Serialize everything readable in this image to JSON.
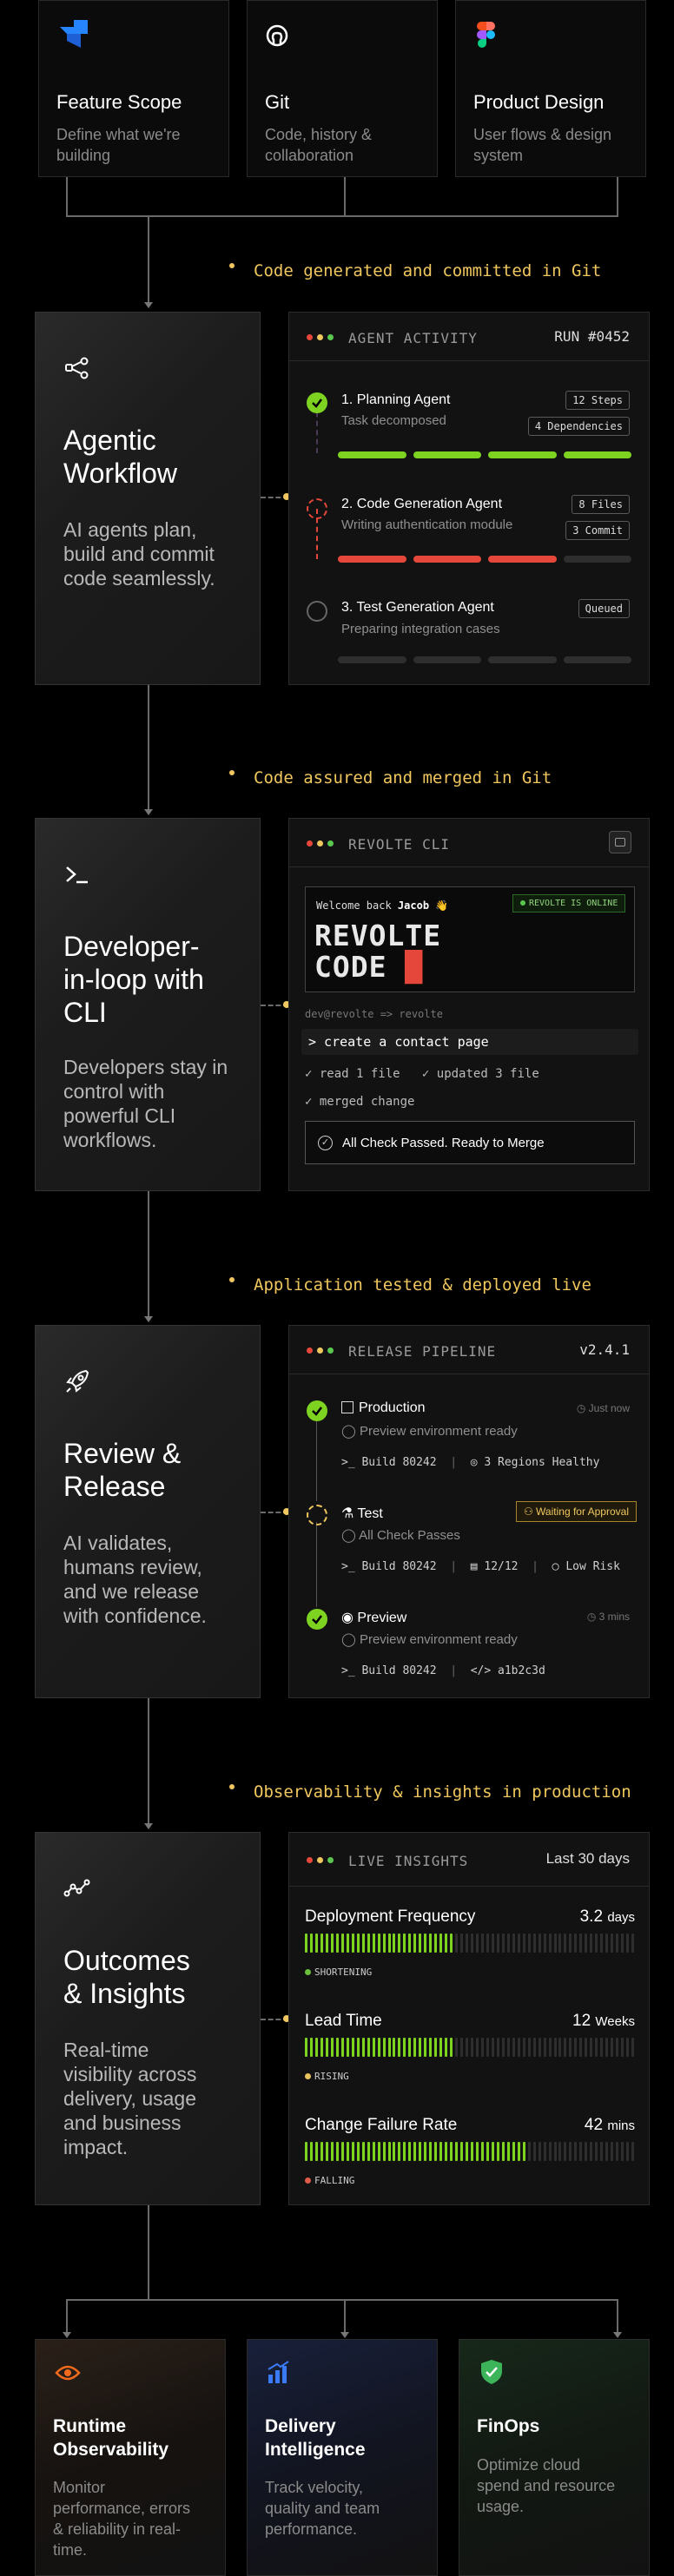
{
  "top_cards": [
    {
      "title": "Feature Scope",
      "desc": "Define what we're building",
      "icon": "jira-icon"
    },
    {
      "title": "Git",
      "desc": "Code, history & collaboration",
      "icon": "github-icon"
    },
    {
      "title": "Product Design",
      "desc": "User flows & design system",
      "icon": "figma-icon"
    }
  ],
  "captions": [
    "Code generated and committed in Git",
    "Code assured and merged in Git",
    "Application tested & deployed live",
    "Observability & insights in production"
  ],
  "flows": [
    {
      "title": "Agentic Workflow",
      "desc": "AI agents plan, build and commit code seamlessly.",
      "icon": "workflow-icon"
    },
    {
      "title": "Developer-in-loop with CLI",
      "desc": "Developers stay in control with powerful CLI workflows.",
      "icon": "terminal-icon"
    },
    {
      "title": "Review & Release",
      "desc": "AI validates, humans review, and we release with confidence.",
      "icon": "rocket-icon"
    },
    {
      "title": "Outcomes & Insights",
      "desc": "Real-time visibility across delivery, usage and business impact.",
      "icon": "insights-icon"
    }
  ],
  "agent": {
    "title": "AGENT ACTIVITY",
    "run": "RUN #0452",
    "steps": [
      {
        "name": "1. Planning Agent",
        "sub": "Task decomposed",
        "tags": [
          "12 Steps",
          "4 Dependencies"
        ],
        "status": "done",
        "progress": 1.0
      },
      {
        "name": "2. Code Generation Agent",
        "sub": "Writing authentication module",
        "tags": [
          "8 Files",
          "3 Commit"
        ],
        "status": "running",
        "progress": 0.7
      },
      {
        "name": "3. Test Generation Agent",
        "sub": "Preparing integration cases",
        "tags": [
          "Queued"
        ],
        "status": "queued",
        "progress": 0
      }
    ]
  },
  "cli": {
    "title": "REVOLTE CLI",
    "welcome_prefix": "Welcome back ",
    "user": "Jacob",
    "wave": "👋",
    "online": "REVOLTE IS ONLINE",
    "logo_line1": "REVOLTE",
    "logo_line2": "CODE",
    "prompt": "dev@revolte => revolte",
    "command": "> create a contact page",
    "results": [
      "read 1 file",
      "updated 3 file",
      "merged change"
    ],
    "check": "All Check Passed. Ready to Merge"
  },
  "pipeline": {
    "title": "RELEASE PIPELINE",
    "version": "v2.4.1",
    "stages": [
      {
        "name": "Production",
        "status_text": "Preview environment ready",
        "time": "Just now",
        "build": "Build 80242",
        "meta": [
          "3 Regions Healthy"
        ],
        "state": "done"
      },
      {
        "name": "Test",
        "status_text": "All Check Passes",
        "badge": "Waiting for Approval",
        "build": "Build 80242",
        "meta": [
          "12/12",
          "Low Risk"
        ],
        "state": "pending"
      },
      {
        "name": "Preview",
        "status_text": "Preview environment ready",
        "time": "3 mins",
        "build": "Build 80242",
        "meta": [
          "a1b2c3d"
        ],
        "state": "done"
      }
    ]
  },
  "insights": {
    "title": "LIVE INSIGHTS",
    "range": "Last 30 days",
    "metrics": [
      {
        "name": "Deployment Frequency",
        "value": "3.2",
        "unit": "days",
        "trend": "SHORTENING",
        "trend_color": "#6bbf3a",
        "fill": 0.46
      },
      {
        "name": "Lead Time",
        "value": "12",
        "unit": "Weeks",
        "trend": "RISING",
        "trend_color": "#e8c25a",
        "fill": 0.46
      },
      {
        "name": "Change Failure Rate",
        "value": "42",
        "unit": "mins",
        "trend": "FALLING",
        "trend_color": "#e05a4a",
        "fill": 0.67
      }
    ]
  },
  "bottom_cards": [
    {
      "title": "Runtime Observability",
      "desc": "Monitor performance, errors & reliability in real-time.",
      "icon": "eye-icon",
      "color": "#f26b1d"
    },
    {
      "title": "Delivery Intelligence",
      "desc": "Track velocity, quality and team performance.",
      "icon": "bar-chart-icon",
      "color": "#3a7bf5"
    },
    {
      "title": "FinOps",
      "desc": "Optimize cloud spend and resource usage.",
      "icon": "shield-check-icon",
      "color": "#3cb45a"
    }
  ],
  "colors": {
    "accent_yellow": "#f0c75e",
    "green": "#7ed321",
    "red": "#e5483a"
  }
}
